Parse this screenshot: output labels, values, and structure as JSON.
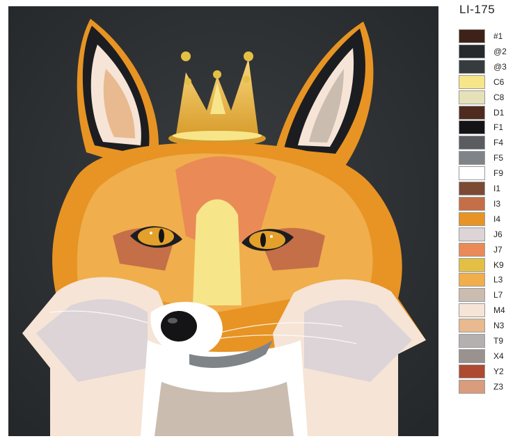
{
  "code": "LI-175",
  "palette": [
    {
      "label": "#1",
      "color": "#3e2119"
    },
    {
      "label": "@2",
      "color": "#262a2c"
    },
    {
      "label": "@3",
      "color": "#363b3e"
    },
    {
      "label": "C6",
      "color": "#f7e58a"
    },
    {
      "label": "C8",
      "color": "#e6e1b8"
    },
    {
      "label": "D1",
      "color": "#4f2b1f"
    },
    {
      "label": "F1",
      "color": "#141416"
    },
    {
      "label": "F4",
      "color": "#5a5c60"
    },
    {
      "label": "F5",
      "color": "#7f8488"
    },
    {
      "label": "F9",
      "color": "#ffffff"
    },
    {
      "label": "I1",
      "color": "#7c4a34"
    },
    {
      "label": "I3",
      "color": "#c46f48"
    },
    {
      "label": "I4",
      "color": "#e79424"
    },
    {
      "label": "J6",
      "color": "#dcd4d6"
    },
    {
      "label": "J7",
      "color": "#ea8a57"
    },
    {
      "label": "K9",
      "color": "#e3c044"
    },
    {
      "label": "L3",
      "color": "#f0ae4c"
    },
    {
      "label": "L7",
      "color": "#cbbcb0"
    },
    {
      "label": "M4",
      "color": "#f6e4d6"
    },
    {
      "label": "N3",
      "color": "#e9b98f"
    },
    {
      "label": "T9",
      "color": "#b4b0b0"
    },
    {
      "label": "X4",
      "color": "#9a9290"
    },
    {
      "label": "Y2",
      "color": "#ad4a30"
    },
    {
      "label": "Z3",
      "color": "#d99c7c"
    }
  ]
}
